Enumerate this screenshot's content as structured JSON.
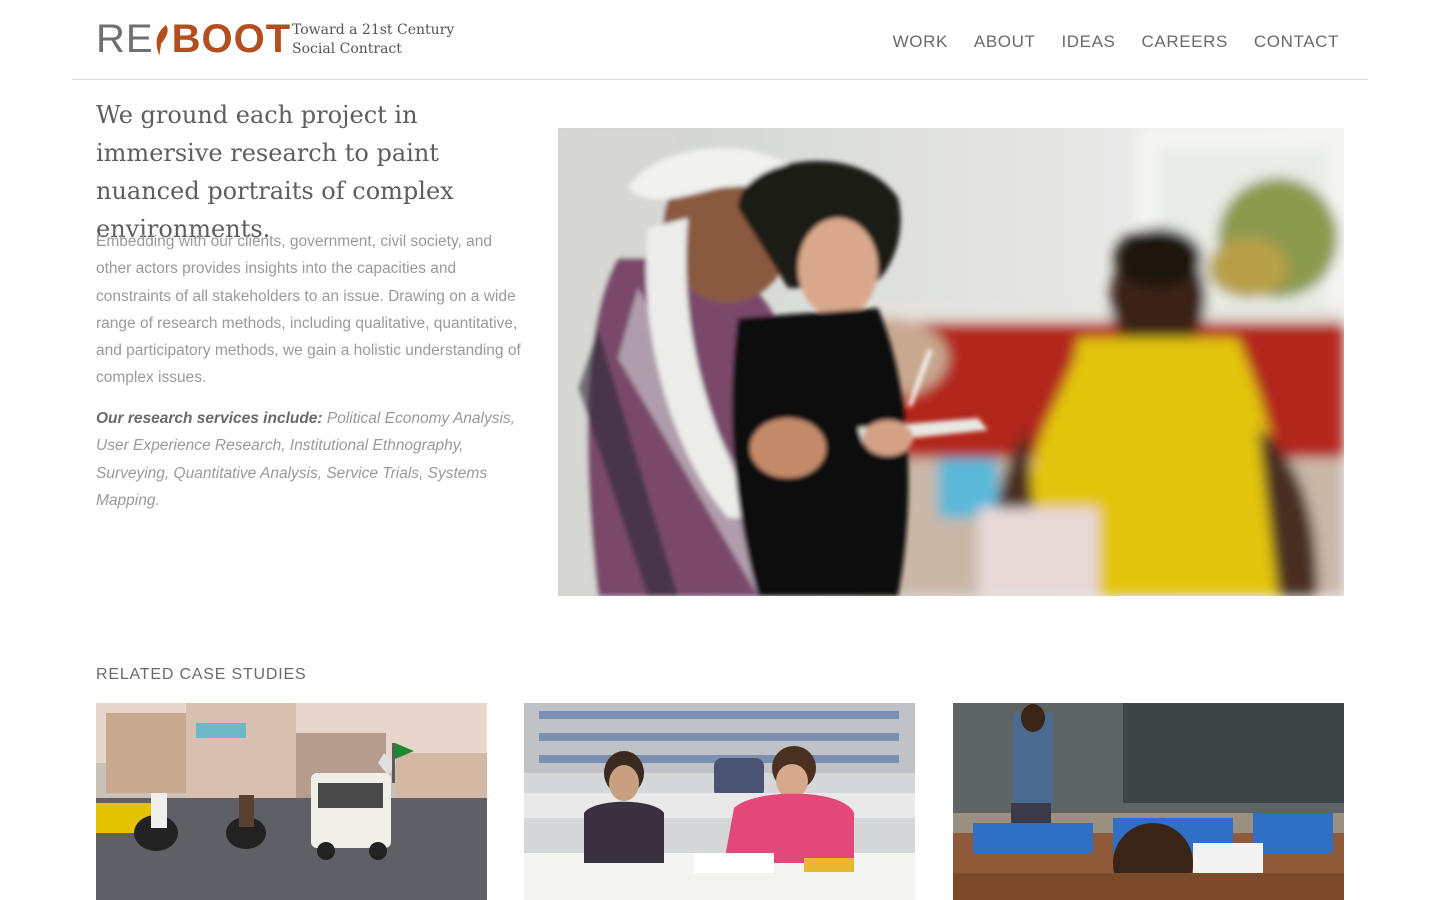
{
  "brand": {
    "logo_re": "RE",
    "logo_boot": "BOOT",
    "tagline_line1": "Toward a 21st Century",
    "tagline_line2": "Social Contract",
    "accent_color": "#b54e1e"
  },
  "nav": {
    "items": [
      {
        "label": "WORK"
      },
      {
        "label": "ABOUT"
      },
      {
        "label": "IDEAS"
      },
      {
        "label": "CAREERS"
      },
      {
        "label": "CONTACT"
      }
    ]
  },
  "main": {
    "lead": "We ground each project in immersive research to paint nuanced portraits of complex environments.",
    "body": "Embedding with our clients, government, civil society, and other actors provides insights into the capacities and constraints of all stakeholders to an issue. Drawing on a wide range of research methods, including qualitative, quantitative, and participatory methods, we gain a holistic understanding of complex issues.",
    "services_label": "Our research services include:",
    "services_list": "Political Economy Analysis, User Experience Research, Institutional Ethnography, Surveying, Quantitative Analysis, Service Trials, Systems Mapping."
  },
  "related": {
    "title": "RELATED CASE STUDIES"
  }
}
